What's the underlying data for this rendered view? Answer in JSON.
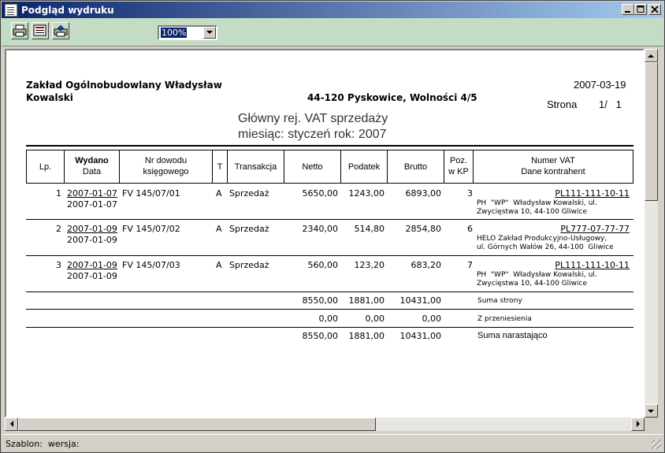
{
  "window": {
    "title": "Podgląd wydruku"
  },
  "toolbar": {
    "zoom": "100%"
  },
  "status": {
    "text": "Szablon:  wersja:"
  },
  "report": {
    "company_line1": "Zakład Ogólnobudowlany  Władysław",
    "company_line2": "Kowalski",
    "address": "44-120 Pyskowice, Wolności 4/5",
    "date": "2007-03-19",
    "page_label": "Strona",
    "page_value": "1/   1",
    "title1": "Główny rej. VAT sprzedaży",
    "title2": "miesiąc: styczeń rok: 2007",
    "headers": {
      "lp": "Lp.",
      "wydano": "Wydano",
      "data": "Data",
      "nr1": "Nr dowodu",
      "nr2": "księgowego",
      "t": "T",
      "transakcja": "Transakcja",
      "netto": "Netto",
      "podatek": "Podatek",
      "brutto": "Brutto",
      "poz1": "Poz.",
      "poz2": "w KP",
      "vat1": "Numer VAT",
      "vat2": "Dane kontrahent"
    },
    "rows": [
      {
        "lp": "1",
        "wydano": "2007-01-07",
        "data": "2007-01-07",
        "nr": "FV 145/07/01",
        "t": "A",
        "transakcja": "Sprzedaż",
        "netto": "5650,00",
        "podatek": "1243,00",
        "brutto": "6893,00",
        "poz": "3",
        "vat": "PL111-111-10-11",
        "kontr1": "PH  \"WP\"  Władysław Kowalski, ul.",
        "kontr2": "Zwycięstwa 10, 44-100 Gliwice"
      },
      {
        "lp": "2",
        "wydano": "2007-01-09",
        "data": "2007-01-09",
        "nr": "FV 145/07/02",
        "t": "A",
        "transakcja": "Sprzedaż",
        "netto": "2340,00",
        "podatek": "514,80",
        "brutto": "2854,80",
        "poz": "6",
        "vat": "PL777-07-77-77",
        "kontr1": "HELO Zakład Produkcyjno-Usługowy,",
        "kontr2": "ul. Górnych Wałów 26, 44-100  Gliwice"
      },
      {
        "lp": "3",
        "wydano": "2007-01-09",
        "data": "2007-01-09",
        "nr": "FV 145/07/03",
        "t": "A",
        "transakcja": "Sprzedaż",
        "netto": "560,00",
        "podatek": "123,20",
        "brutto": "683,20",
        "poz": "7",
        "vat": "PL111-111-10-11",
        "kontr1": "PH  \"WP\"  Władysław Kowalski, ul.",
        "kontr2": "Zwycięstwa 10, 44-100 Gliwice"
      }
    ],
    "totals": [
      {
        "netto": "8550,00",
        "podatek": "1881,00",
        "brutto": "10431,00",
        "label": "Suma strony"
      },
      {
        "netto": "0,00",
        "podatek": "0,00",
        "brutto": "0,00",
        "label": "Z przeniesienia"
      },
      {
        "netto": "8550,00",
        "podatek": "1881,00",
        "brutto": "10431,00",
        "label": "Suma narastająco"
      }
    ]
  }
}
